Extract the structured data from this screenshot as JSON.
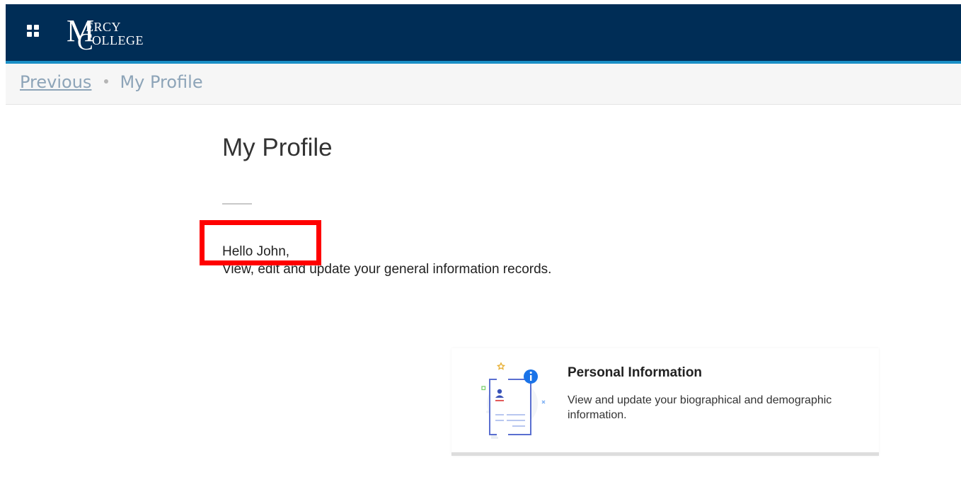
{
  "header": {
    "logo_alt": "Mercy College"
  },
  "breadcrumb": {
    "previous": "Previous",
    "current": "My Profile"
  },
  "main": {
    "title": "My Profile",
    "greeting": "Hello John,",
    "subtitle": "View, edit and update your general information records."
  },
  "cards": [
    {
      "title": "Personal Information",
      "description": "View and update your biographical and demographic information.",
      "icon": "personal-information-illustration"
    }
  ],
  "colors": {
    "header_bg": "#002d56",
    "header_accent": "#1b8fc6",
    "breadcrumb_text": "#8da4b8",
    "highlight": "#ff0000"
  }
}
